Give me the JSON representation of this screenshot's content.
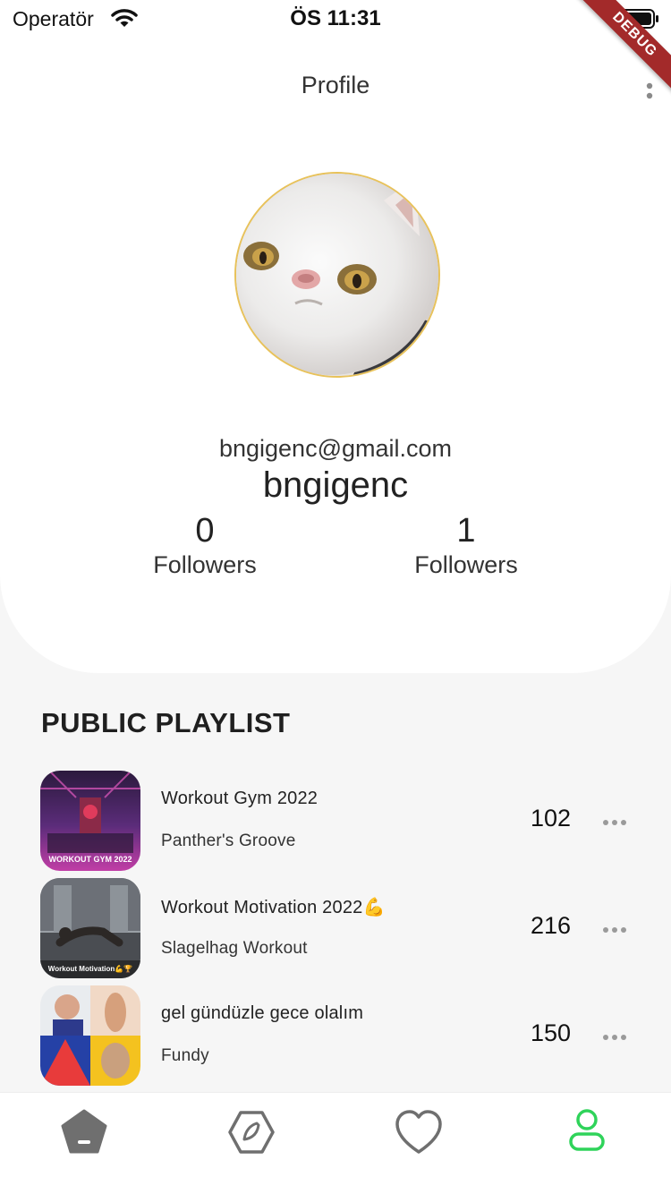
{
  "status_bar": {
    "carrier": "Operatör",
    "time": "ÖS 11:31",
    "icons": [
      "wifi-icon",
      "battery-icon"
    ]
  },
  "debug_banner": "DEBUG",
  "header": {
    "title": "Profile",
    "menu_icon": "more-vertical-icon"
  },
  "profile": {
    "email": "bngigenc@gmail.com",
    "username": "bngigenc",
    "stats": [
      {
        "count": "0",
        "label": "Followers"
      },
      {
        "count": "1",
        "label": "Followers"
      }
    ]
  },
  "playlist_section": {
    "title": "PUBLIC PLAYLIST",
    "items": [
      {
        "title": "Workout Gym 2022",
        "artist": "Panther's Groove",
        "count": "102",
        "thumb_caption": "WORKOUT GYM 2022"
      },
      {
        "title": "Workout Motivation 2022💪",
        "artist": "Slagelhag Workout",
        "count": "216",
        "thumb_caption": "Workout Motivation💪🏆"
      },
      {
        "title": "gel gündüzle gece olalım",
        "artist": "Fundy",
        "count": "150"
      }
    ]
  },
  "bottom_nav": {
    "items": [
      "home-icon",
      "discover-icon",
      "favorites-icon",
      "profile-icon"
    ],
    "active": "profile-icon",
    "active_color": "#2fd35a",
    "inactive_color": "#6f6f6f"
  }
}
